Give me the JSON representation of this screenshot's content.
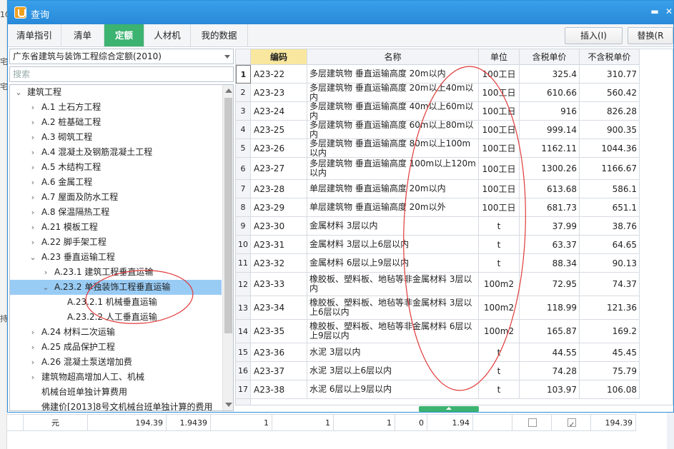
{
  "window": {
    "title": "查询"
  },
  "background": {
    "left_snippets": [
      "10",
      "宅",
      "宅",
      "持"
    ]
  },
  "tabs": [
    {
      "label": "清单指引",
      "active": false
    },
    {
      "label": "清单",
      "active": false
    },
    {
      "label": "定额",
      "active": true
    },
    {
      "label": "人材机",
      "active": false
    },
    {
      "label": "我的数据",
      "active": false
    }
  ],
  "toolbar": {
    "insert_label": "插入(I)",
    "replace_label": "替换(R"
  },
  "library": {
    "selected": "广东省建筑与装饰工程综合定额(2010)"
  },
  "search": {
    "placeholder": "搜索"
  },
  "tree": [
    {
      "label": "建筑工程",
      "toggle": "⌄",
      "level": 0
    },
    {
      "label": "A.1 土石方工程",
      "toggle": "›",
      "level": 1
    },
    {
      "label": "A.2 桩基础工程",
      "toggle": "›",
      "level": 1
    },
    {
      "label": "A.3 砌筑工程",
      "toggle": "›",
      "level": 1
    },
    {
      "label": "A.4 混凝土及钢筋混凝土工程",
      "toggle": "›",
      "level": 1
    },
    {
      "label": "A.5 木结构工程",
      "toggle": "›",
      "level": 1
    },
    {
      "label": "A.6 金属工程",
      "toggle": "›",
      "level": 1
    },
    {
      "label": "A.7 屋面及防水工程",
      "toggle": "›",
      "level": 1
    },
    {
      "label": "A.8 保温隔热工程",
      "toggle": "›",
      "level": 1
    },
    {
      "label": "A.21 模板工程",
      "toggle": "›",
      "level": 1
    },
    {
      "label": "A.22 脚手架工程",
      "toggle": "›",
      "level": 1
    },
    {
      "label": "A.23 垂直运输工程",
      "toggle": "⌄",
      "level": 1
    },
    {
      "label": "A.23.1 建筑工程垂直运输",
      "toggle": "›",
      "level": 2
    },
    {
      "label": "A.23.2 单独装饰工程垂直运输",
      "toggle": "⌄",
      "level": 2,
      "selected": true
    },
    {
      "label": "A.23.2.1 机械垂直运输",
      "toggle": "",
      "level": 3
    },
    {
      "label": "A.23.2.2 人工垂直运输",
      "toggle": "",
      "level": 3
    },
    {
      "label": "A.24 材料二次运输",
      "toggle": "›",
      "level": 1
    },
    {
      "label": "A.25 成品保护工程",
      "toggle": "›",
      "level": 1
    },
    {
      "label": "A.26 混凝土泵送增加费",
      "toggle": "›",
      "level": 1
    },
    {
      "label": "建筑物超高增加人工、机械",
      "toggle": "›",
      "level": 1
    },
    {
      "label": "机械台班单独计算费用",
      "toggle": "",
      "level": 1
    },
    {
      "label": "佛建价[2013]8号文机械台班单独计算的费用",
      "toggle": "",
      "level": 1
    }
  ],
  "table": {
    "headers": {
      "code": "编码",
      "name": "名称",
      "unit": "单位",
      "tax_price": "含税单价",
      "notax_price": "不含税单价"
    },
    "rows": [
      {
        "idx": "1",
        "code": "A23-22",
        "name": "多层建筑物 垂直运输高度 20m以内",
        "unit": "100工日",
        "tax": "325.4",
        "notax": "310.77"
      },
      {
        "idx": "2",
        "code": "A23-23",
        "name": "多层建筑物 垂直运输高度 20m以上40m以内",
        "unit": "100工日",
        "tax": "610.66",
        "notax": "560.42"
      },
      {
        "idx": "3",
        "code": "A23-24",
        "name": "多层建筑物 垂直运输高度 40m以上60m以内",
        "unit": "100工日",
        "tax": "916",
        "notax": "826.28"
      },
      {
        "idx": "4",
        "code": "A23-25",
        "name": "多层建筑物 垂直运输高度 60m以上80m以内",
        "unit": "100工日",
        "tax": "999.14",
        "notax": "900.35"
      },
      {
        "idx": "5",
        "code": "A23-26",
        "name": "多层建筑物 垂直运输高度 80m以上100m以内",
        "unit": "100工日",
        "tax": "1162.11",
        "notax": "1044.36"
      },
      {
        "idx": "6",
        "code": "A23-27",
        "name": "多层建筑物 垂直运输高度 100m以上120m以内",
        "unit": "100工日",
        "tax": "1300.26",
        "notax": "1166.67"
      },
      {
        "idx": "7",
        "code": "A23-28",
        "name": "单层建筑物 垂直运输高度 20m以内",
        "unit": "100工日",
        "tax": "613.68",
        "notax": "586.1"
      },
      {
        "idx": "8",
        "code": "A23-29",
        "name": "单层建筑物 垂直运输高度 20m以外",
        "unit": "100工日",
        "tax": "681.73",
        "notax": "651.1"
      },
      {
        "idx": "9",
        "code": "A23-30",
        "name": "金属材料 3层以内",
        "unit": "t",
        "tax": "37.99",
        "notax": "38.76"
      },
      {
        "idx": "10",
        "code": "A23-31",
        "name": "金属材料 3层以上6层以内",
        "unit": "t",
        "tax": "63.37",
        "notax": "64.65"
      },
      {
        "idx": "11",
        "code": "A23-32",
        "name": "金属材料 6层以上9层以内",
        "unit": "t",
        "tax": "88.34",
        "notax": "90.13"
      },
      {
        "idx": "12",
        "code": "A23-33",
        "name": "橡胶板、塑料板、地毡等非金属材料 3层以内",
        "unit": "100m2",
        "tax": "72.95",
        "notax": "74.37"
      },
      {
        "idx": "13",
        "code": "A23-34",
        "name": "橡胶板、塑料板、地毡等非金属材料 3层以上6层以内",
        "unit": "100m2",
        "tax": "118.99",
        "notax": "121.36"
      },
      {
        "idx": "14",
        "code": "A23-35",
        "name": "橡胶板、塑料板、地毡等非金属材料 6层以上9层以内",
        "unit": "100m2",
        "tax": "165.87",
        "notax": "169.2"
      },
      {
        "idx": "15",
        "code": "A23-36",
        "name": "水泥 3层以内",
        "unit": "t",
        "tax": "44.55",
        "notax": "45.45"
      },
      {
        "idx": "16",
        "code": "A23-37",
        "name": "水泥 3层以上6层以内",
        "unit": "t",
        "tax": "74.28",
        "notax": "75.79"
      },
      {
        "idx": "17",
        "code": "A23-38",
        "name": "水泥 6层以上9层以内",
        "unit": "t",
        "tax": "103.97",
        "notax": "106.08"
      }
    ]
  },
  "footer": {
    "cells": [
      "元",
      "194.39",
      "1.9439",
      "1",
      "1",
      "1",
      "0",
      "1.94",
      "",
      "",
      "194.39"
    ],
    "checkbox_1": false,
    "checkbox_2": true
  },
  "colors": {
    "title_bar": "#2889d8",
    "active_tab": "#3cb371",
    "selected_row": "#99ccf5",
    "annotation": "#e03a3a"
  }
}
